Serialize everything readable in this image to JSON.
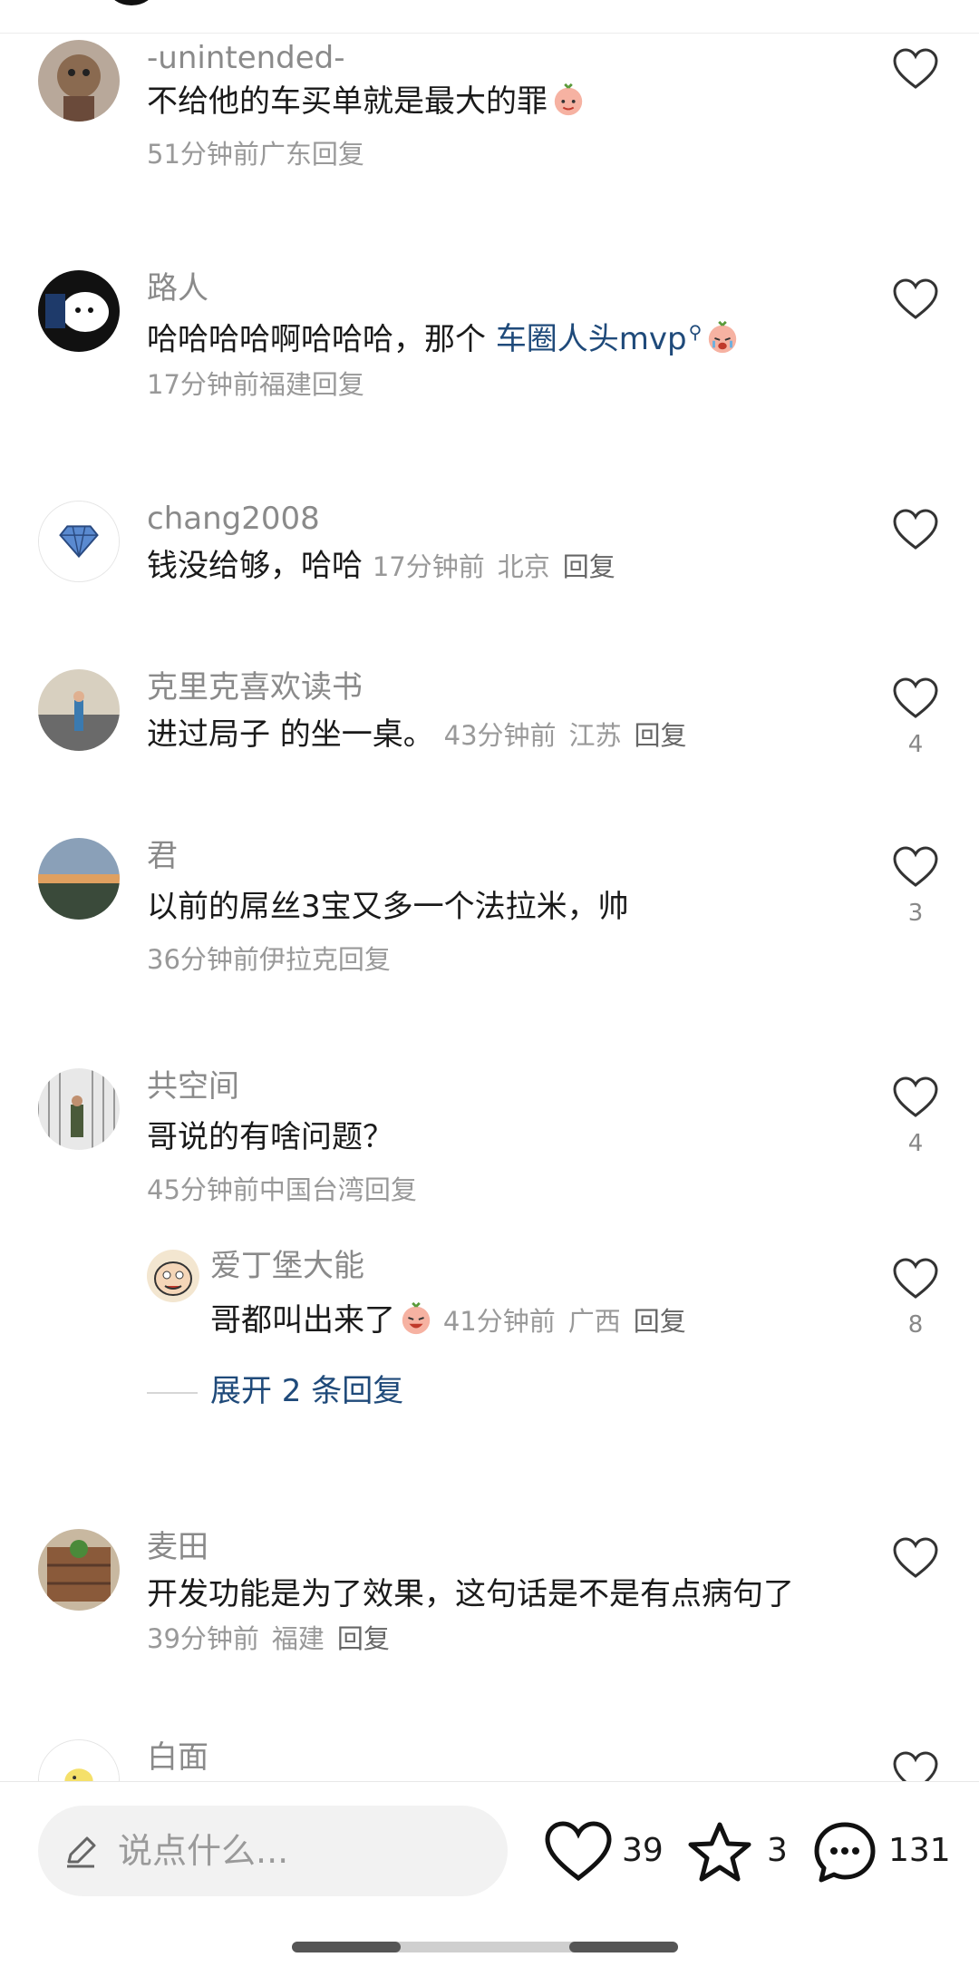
{
  "comments": [
    {
      "user": "-unintended-",
      "text": "不给他的车买单就是最大的罪",
      "time": "51分钟前",
      "region": "广东",
      "reply": "回复",
      "likes": ""
    },
    {
      "user": "路人",
      "text_before": "哈哈哈哈啊哈哈哈，那个 ",
      "link": "车圈人头mvp",
      "time": "17分钟前",
      "region": "福建",
      "reply": "回复",
      "likes": ""
    },
    {
      "user": "chang2008",
      "text": "钱没给够，哈哈",
      "time": "17分钟前",
      "region": "北京",
      "reply": "回复",
      "likes": ""
    },
    {
      "user": "克里克喜欢读书",
      "text": "进过局子 的坐一桌。",
      "time": "43分钟前",
      "region": "江苏",
      "reply": "回复",
      "likes": "4"
    },
    {
      "user": "君",
      "text": "以前的屌丝3宝又多一个法拉米，帅",
      "time": "36分钟前",
      "region": "伊拉克",
      "reply": "回复",
      "likes": "3"
    },
    {
      "user": "共空间",
      "text": "哥说的有啥问题？",
      "time": "45分钟前",
      "region": "中国台湾",
      "reply": "回复",
      "likes": "4"
    },
    {
      "user": "麦田",
      "text": "开发功能是为了效果，这句话是不是有点病句了",
      "time": "39分钟前",
      "region": "福建",
      "reply": "回复",
      "likes": ""
    },
    {
      "user": "白面"
    }
  ],
  "sub_reply": {
    "user": "爱丁堡大能",
    "text": "哥都叫出来了",
    "time": "41分钟前",
    "region": "广西",
    "reply": "回复",
    "likes": "8"
  },
  "expand_label": "展开 2 条回复",
  "bottom": {
    "placeholder": "说点什么...",
    "likes": "39",
    "favorites": "3",
    "comments": "131"
  },
  "icons": [
    "heart-icon",
    "star-icon",
    "chat-bubble-icon",
    "pencil-icon"
  ],
  "colors": {
    "link": "#1f4a7a",
    "meta": "#999999",
    "username": "#8a8a8a"
  }
}
